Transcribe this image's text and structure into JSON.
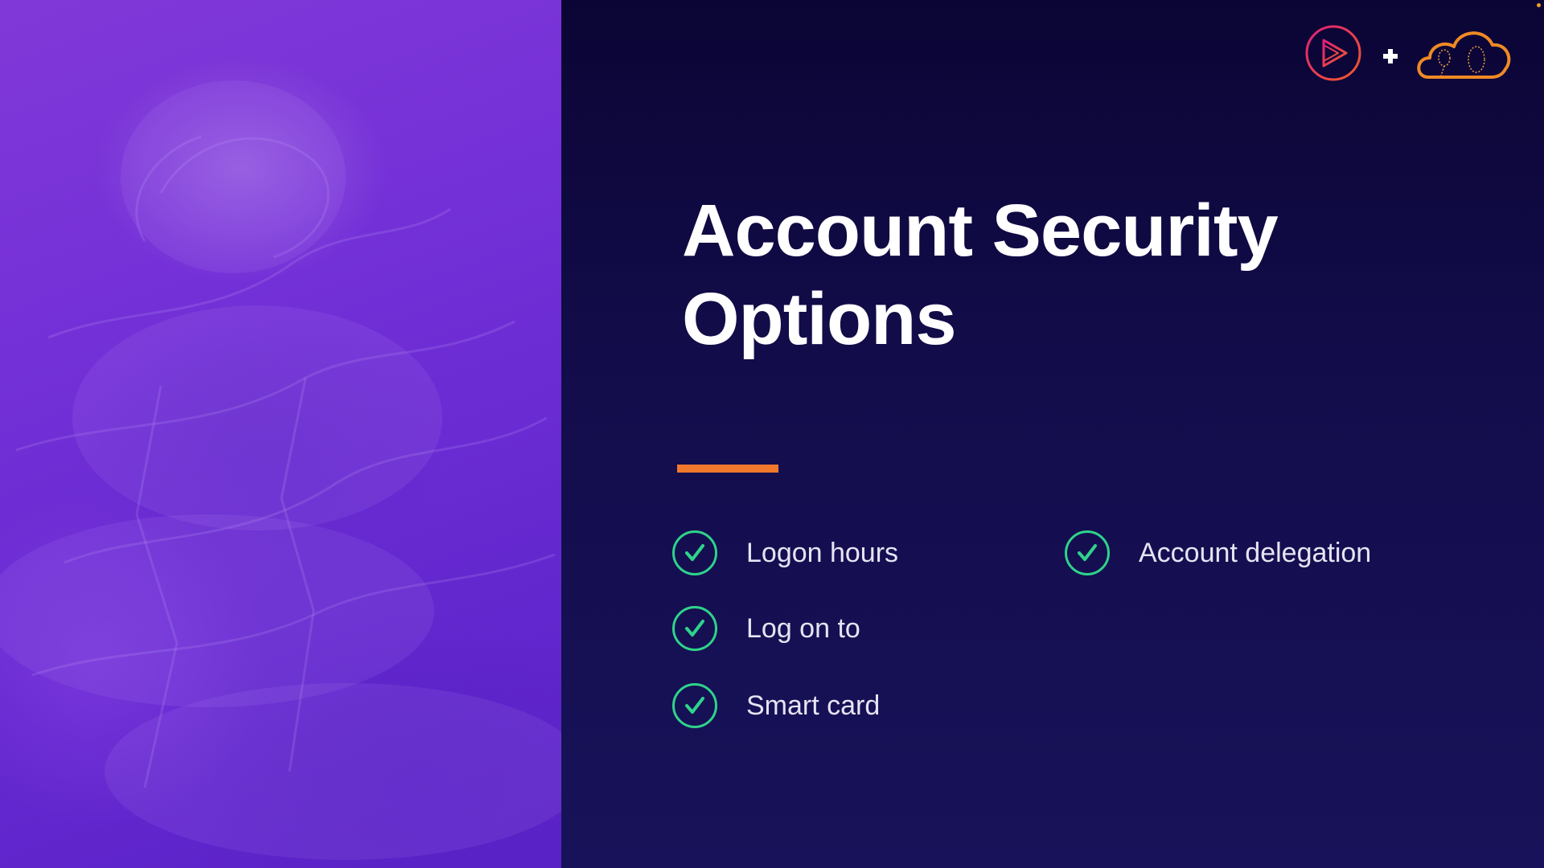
{
  "slide": {
    "title": "Account Security Options",
    "accent_color": "#f0782d",
    "check_color": "#2fd38a",
    "background_color": "#130d4c"
  },
  "logos": {
    "left_logo": "play-logo-icon",
    "separator": "+",
    "right_logo": "cloud-logo-icon"
  },
  "options": [
    {
      "label": "Logon hours",
      "icon": "check-circle-icon"
    },
    {
      "label": "Log on to",
      "icon": "check-circle-icon"
    },
    {
      "label": "Smart card",
      "icon": "check-circle-icon"
    },
    {
      "label": "Account delegation",
      "icon": "check-circle-icon"
    }
  ]
}
